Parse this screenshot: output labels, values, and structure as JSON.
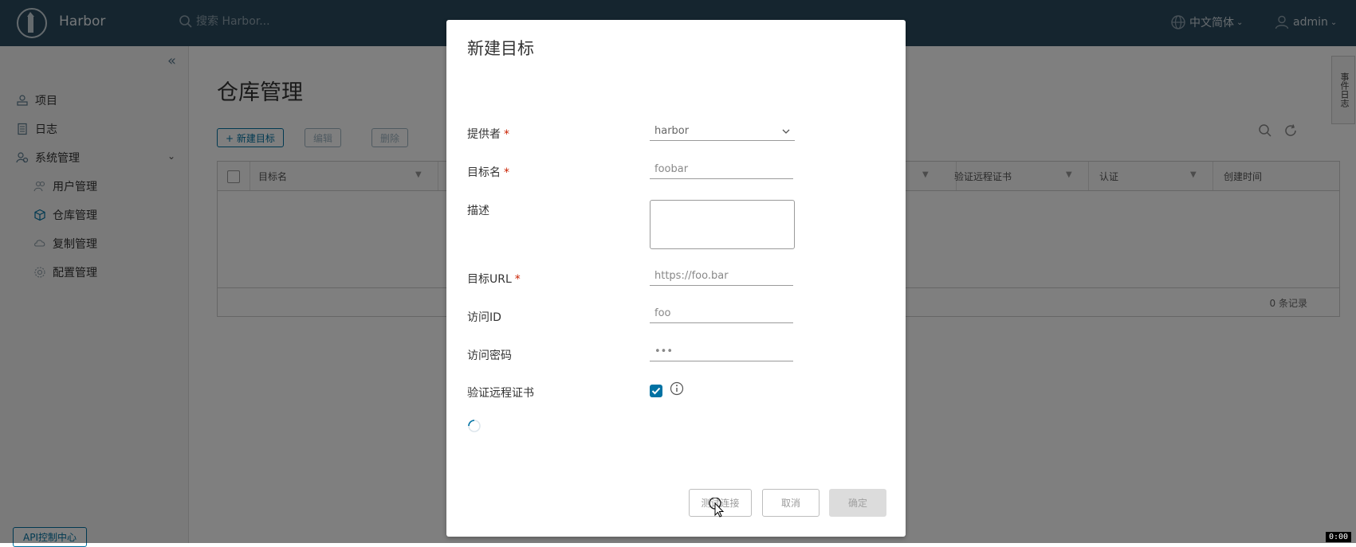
{
  "header": {
    "brand": "Harbor",
    "search_placeholder": "搜索 Harbor...",
    "language": "中文简体",
    "user": "admin",
    "color": "#2b4a5f"
  },
  "sidebar": {
    "items": [
      {
        "label": "项目",
        "icon": "projects-icon"
      },
      {
        "label": "日志",
        "icon": "logs-icon"
      },
      {
        "label": "系统管理",
        "icon": "admin-icon"
      }
    ],
    "sub_items": [
      {
        "label": "用户管理",
        "icon": "users-icon"
      },
      {
        "label": "仓库管理",
        "icon": "registry-icon"
      },
      {
        "label": "复制管理",
        "icon": "replication-icon"
      },
      {
        "label": "配置管理",
        "icon": "config-icon"
      }
    ],
    "api_button": "API控制中心"
  },
  "main": {
    "title": "仓库管理",
    "toolbar": {
      "new_label": "+ 新建目标",
      "edit_label": "编辑",
      "delete_label": "删除"
    },
    "columns": [
      "目标名",
      "验证远程证书",
      "认证",
      "创建时间"
    ],
    "footer": "0 条记录",
    "right_tab": "事件日志"
  },
  "modal": {
    "title": "新建目标",
    "fields": {
      "provider": {
        "label": "提供者",
        "value": "harbor"
      },
      "name": {
        "label": "目标名",
        "placeholder": "foobar"
      },
      "description": {
        "label": "描述"
      },
      "url": {
        "label": "目标URL",
        "placeholder": "https://foo.bar"
      },
      "access_id": {
        "label": "访问ID",
        "placeholder": "foo"
      },
      "access_secret": {
        "label": "访问密码",
        "placeholder": "•••"
      },
      "verify_cert": {
        "label": "验证远程证书",
        "checked": true
      }
    },
    "buttons": {
      "test": "测试连接",
      "cancel": "取消",
      "ok": "确定"
    },
    "required_mark": "*"
  },
  "timecode": "0:00",
  "accent_color": "#0072a3"
}
